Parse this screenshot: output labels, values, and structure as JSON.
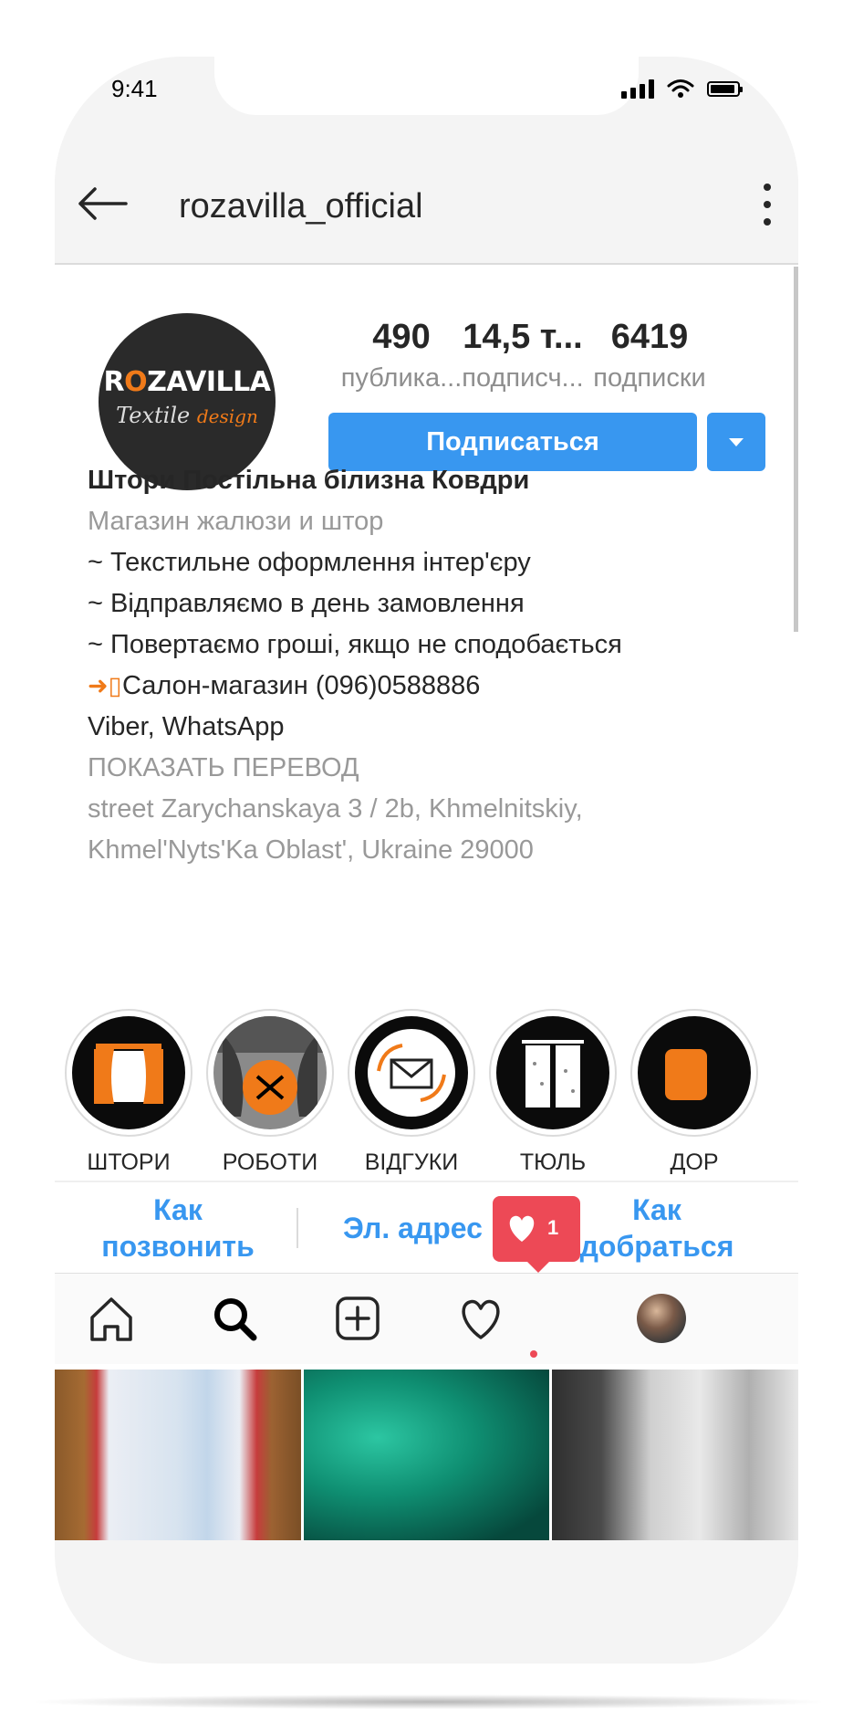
{
  "status_bar": {
    "time": "9:41"
  },
  "header": {
    "username": "rozavilla_official"
  },
  "profile": {
    "logo": {
      "brand_pre": "R",
      "brand_o": "O",
      "brand_post": "ZAVILLA",
      "sub_main": "Textile ",
      "sub_accent": "design"
    },
    "stats": [
      {
        "value": "490",
        "label": "публика..."
      },
      {
        "value": "14,5 т...",
        "label": "подписч..."
      },
      {
        "value": "6419",
        "label": "подписки"
      }
    ],
    "follow_label": "Подписаться"
  },
  "bio": {
    "name": "Штори Постільна білизна Ковдри",
    "category": "Магазин жалюзи и штор",
    "lines": [
      " ~ Текстильне оформлення інтер'єру",
      " ~ Відправляємо в день замовлення",
      " ~ Повертаємо гроші, якщо не сподобається"
    ],
    "phone_line": "Салон-магазин (096)0588886",
    "messengers": "Viber, WhatsApp",
    "translate": "ПОКАЗАТЬ ПЕРЕВОД",
    "address_line1": "street Zarychanskaya 3 / 2b, Khmelnitskiy,",
    "address_line2": "Khmel'Nyts'Ka Oblast', Ukraine 29000"
  },
  "highlights": [
    {
      "label": "ШТОРИ"
    },
    {
      "label": "РОБОТИ"
    },
    {
      "label": "ВІДГУКИ"
    },
    {
      "label": "ТЮЛЬ"
    },
    {
      "label": "ДОР"
    }
  ],
  "contacts": {
    "call": {
      "line1": "Как",
      "line2": "позвонить"
    },
    "email": "Эл. адрес",
    "directions": {
      "line1": "Как",
      "line2": "добраться"
    }
  },
  "activity": {
    "like_count": "1"
  },
  "colors": {
    "accent": "#3897f0",
    "brand_orange": "#f07a19",
    "like_red": "#ed4956"
  }
}
